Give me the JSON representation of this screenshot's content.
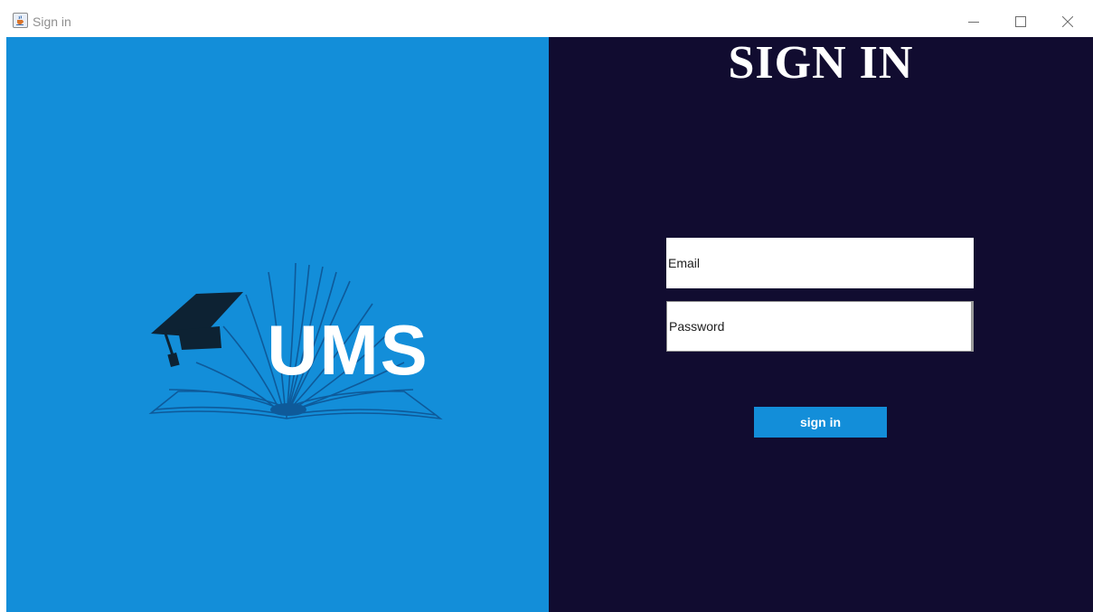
{
  "window": {
    "title": "Sign in",
    "app_icon": "java-cup-icon",
    "controls": [
      "minimize-icon",
      "maximize-icon",
      "close-icon"
    ]
  },
  "logo": {
    "text": "UMS",
    "icons": [
      "graduation-cap-icon",
      "open-book-icon"
    ]
  },
  "form": {
    "heading": "SIGN IN",
    "email_placeholder": "Email",
    "password_placeholder": "Password",
    "submit_label": "sign in"
  },
  "colors": {
    "left_panel": "#138ed9",
    "right_panel": "#110c30",
    "button": "#138ed9",
    "button_text": "#ffffff",
    "heading_text": "#ffffff",
    "field_background": "#ffffff"
  }
}
